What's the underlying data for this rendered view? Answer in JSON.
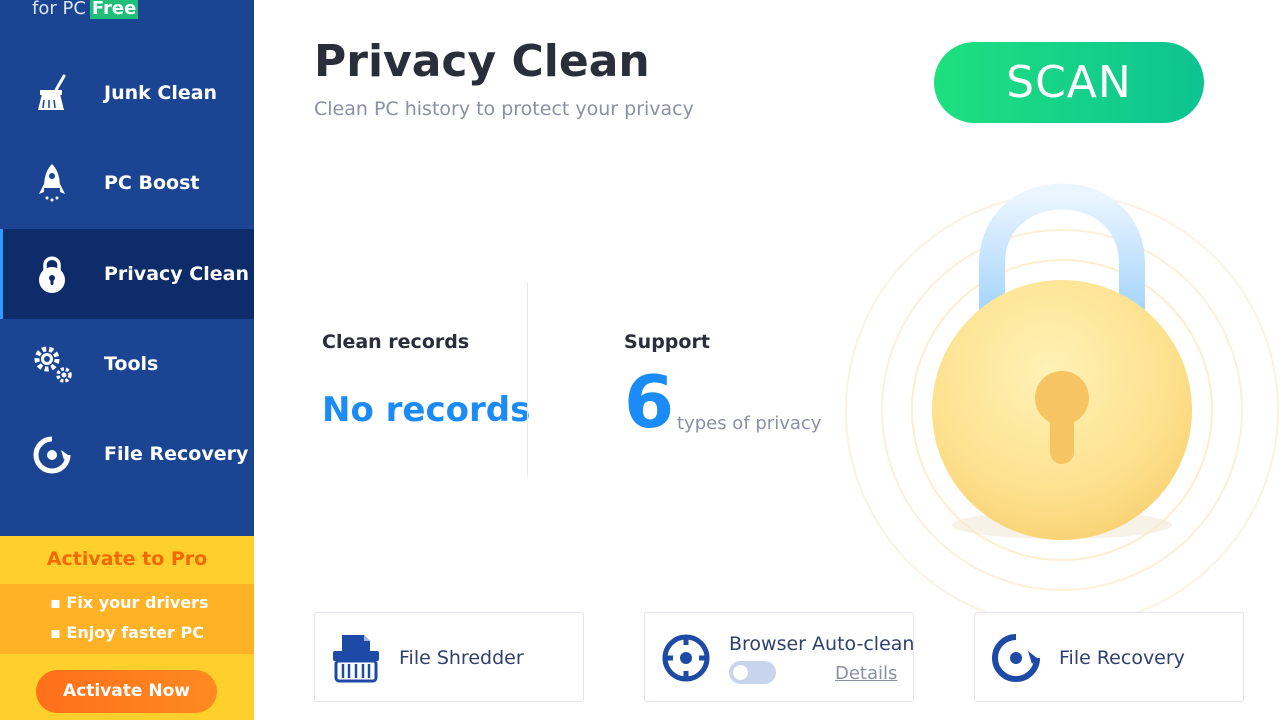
{
  "brand": {
    "text": "for PC",
    "badge": "Free"
  },
  "sidebar": {
    "items": [
      {
        "label": "Junk Clean",
        "icon": "broom-icon"
      },
      {
        "label": "PC Boost",
        "icon": "rocket-icon"
      },
      {
        "label": "Privacy Clean",
        "icon": "lock-icon",
        "active": true
      },
      {
        "label": "Tools",
        "icon": "gears-icon"
      },
      {
        "label": "File Recovery",
        "icon": "recovery-icon"
      }
    ]
  },
  "promo": {
    "title": "Activate to Pro",
    "features": [
      "Fix your drivers",
      "Enjoy faster PC"
    ],
    "button": "Activate Now"
  },
  "main": {
    "title": "Privacy Clean",
    "subtitle": "Clean PC history to protect your privacy",
    "scan_button": "SCAN",
    "clean_records": {
      "label": "Clean records",
      "value": "No records"
    },
    "support": {
      "label": "Support",
      "count": "6",
      "unit": "types of privacy"
    }
  },
  "tools": [
    {
      "label": "File Shredder",
      "icon": "shredder-icon"
    },
    {
      "label": "Browser Auto-clean",
      "icon": "crosshair-icon",
      "toggle_on": false,
      "details_link": "Details"
    },
    {
      "label": "File Recovery",
      "icon": "recovery-icon"
    }
  ],
  "colors": {
    "sidebar_bg": "#1b4593",
    "sidebar_active_bg": "#0f2c6a",
    "accent_blue": "#1b8cf7",
    "scan_green": "#1ee07f",
    "promo_yellow": "#ffcf2c",
    "promo_orange": "#ff7a1f"
  }
}
